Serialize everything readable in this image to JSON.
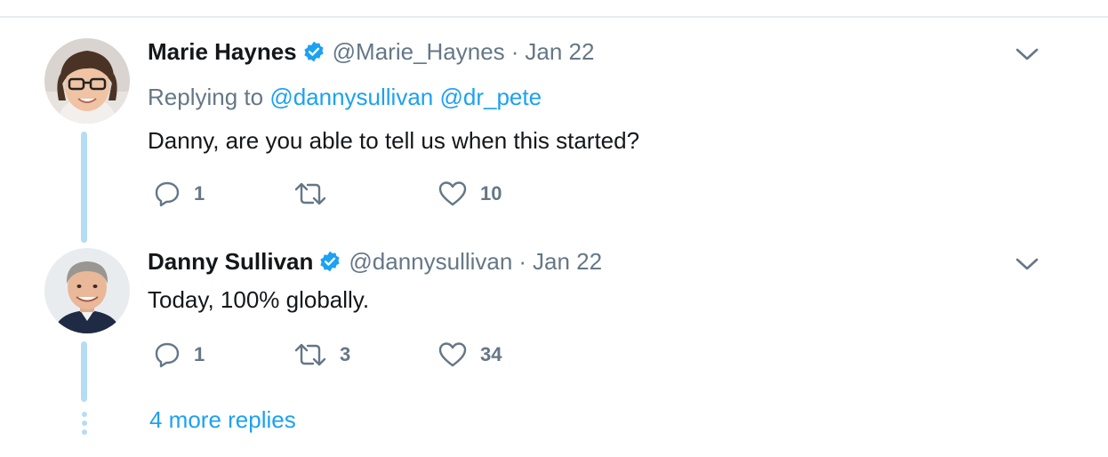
{
  "tweets": [
    {
      "name": "Marie Haynes",
      "handle": "@Marie_Haynes",
      "separator": "·",
      "date": "Jan 22",
      "replying_prefix": "Replying to",
      "replying_to": [
        "@dannysullivan",
        "@dr_pete"
      ],
      "text": "Danny, are you able to tell us when this started?",
      "actions": {
        "reply_count": "1",
        "retweet_count": "",
        "like_count": "10"
      }
    },
    {
      "name": "Danny Sullivan",
      "handle": "@dannysullivan",
      "separator": "·",
      "date": "Jan 22",
      "text": "Today, 100% globally.",
      "actions": {
        "reply_count": "1",
        "retweet_count": "3",
        "like_count": "34"
      }
    }
  ],
  "more_replies": "4 more replies",
  "icons": {
    "verified": "verified-badge-icon",
    "reply": "reply-icon",
    "retweet": "retweet-icon",
    "like": "heart-icon",
    "menu": "chevron-down-icon"
  },
  "colors": {
    "accent": "#1da1f2",
    "muted_text": "#657786",
    "thread_line": "#b6dcf5",
    "verified": "#1da1f2"
  }
}
